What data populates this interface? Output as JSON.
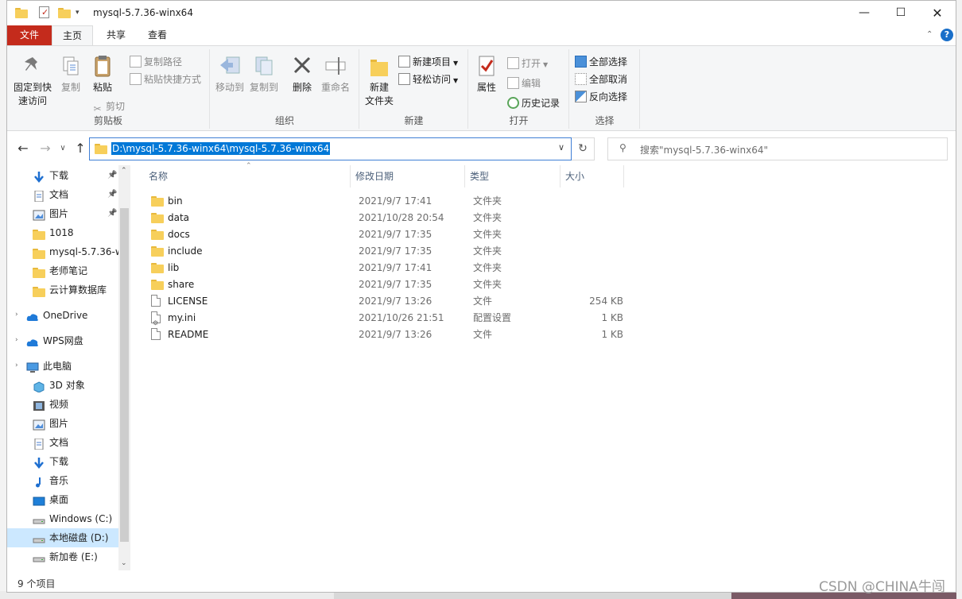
{
  "window": {
    "title": "mysql-5.7.36-winx64"
  },
  "tabs": {
    "file": "文件",
    "home": "主页",
    "share": "共享",
    "view": "查看"
  },
  "ribbon": {
    "pin_label_1": "固定到快",
    "pin_label_2": "速访问",
    "copy": "复制",
    "paste": "粘贴",
    "copy_path": "复制路径",
    "paste_shortcut": "粘贴快捷方式",
    "cut": "剪切",
    "group_clipboard": "剪贴板",
    "move_to": "移动到",
    "copy_to": "复制到",
    "delete": "删除",
    "rename": "重命名",
    "group_organize": "组织",
    "new_folder_1": "新建",
    "new_folder_2": "文件夹",
    "new_item": "新建项目",
    "easy_access": "轻松访问",
    "group_new": "新建",
    "properties": "属性",
    "open": "打开",
    "edit": "编辑",
    "history": "历史记录",
    "group_open": "打开",
    "select_all": "全部选择",
    "select_none": "全部取消",
    "invert_selection": "反向选择",
    "group_select": "选择"
  },
  "address": {
    "path": "D:\\mysql-5.7.36-winx64\\mysql-5.7.36-winx64",
    "search_placeholder": "搜索\"mysql-5.7.36-winx64\""
  },
  "nav": {
    "quick": [
      "下载",
      "文档",
      "图片",
      "1018",
      "mysql-5.7.36-w",
      "老师笔记",
      "云计算数据库"
    ],
    "onedrive": "OneDrive",
    "wps": "WPS网盘",
    "thispc": "此电脑",
    "pc_items": [
      "3D 对象",
      "视频",
      "图片",
      "文档",
      "下载",
      "音乐",
      "桌面",
      "Windows (C:)",
      "本地磁盘 (D:)",
      "新加卷 (E:)"
    ]
  },
  "columns": {
    "name": "名称",
    "modified": "修改日期",
    "type": "类型",
    "size": "大小"
  },
  "files": [
    {
      "name": "bin",
      "date": "2021/9/7 17:41",
      "type": "文件夹",
      "size": "",
      "kind": "folder"
    },
    {
      "name": "data",
      "date": "2021/10/28 20:54",
      "type": "文件夹",
      "size": "",
      "kind": "folder"
    },
    {
      "name": "docs",
      "date": "2021/9/7 17:35",
      "type": "文件夹",
      "size": "",
      "kind": "folder"
    },
    {
      "name": "include",
      "date": "2021/9/7 17:35",
      "type": "文件夹",
      "size": "",
      "kind": "folder"
    },
    {
      "name": "lib",
      "date": "2021/9/7 17:41",
      "type": "文件夹",
      "size": "",
      "kind": "folder"
    },
    {
      "name": "share",
      "date": "2021/9/7 17:35",
      "type": "文件夹",
      "size": "",
      "kind": "folder"
    },
    {
      "name": "LICENSE",
      "date": "2021/9/7 13:26",
      "type": "文件",
      "size": "254 KB",
      "kind": "file"
    },
    {
      "name": "my.ini",
      "date": "2021/10/26 21:51",
      "type": "配置设置",
      "size": "1 KB",
      "kind": "ini"
    },
    {
      "name": "README",
      "date": "2021/9/7 13:26",
      "type": "文件",
      "size": "1 KB",
      "kind": "file"
    }
  ],
  "status": {
    "count": "9 个项目"
  },
  "watermark": "CSDN @CHINA牛闯"
}
